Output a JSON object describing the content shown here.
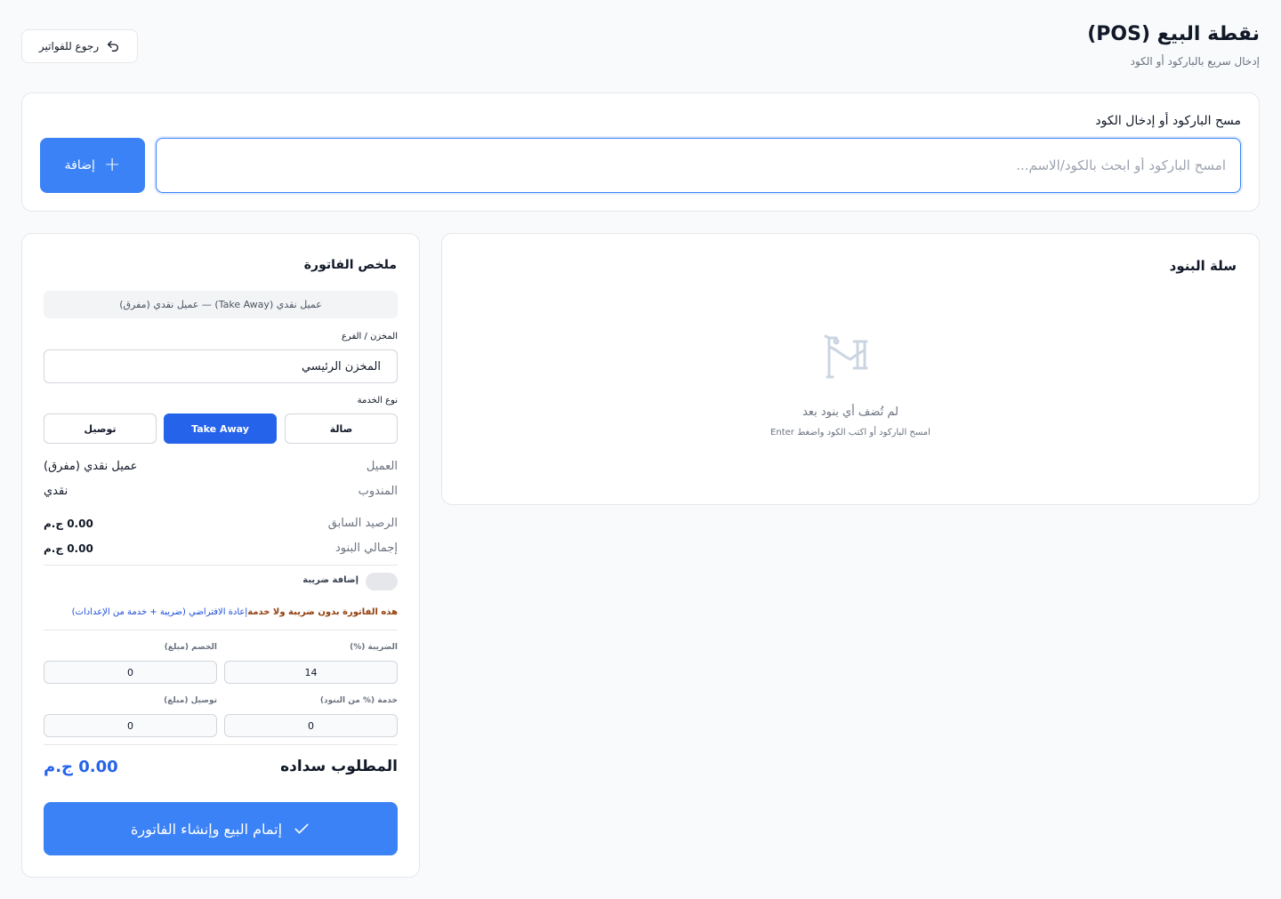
{
  "header": {
    "title": "نقطة البيع (POS)",
    "subtitle": "إدخال سريع بالباركود أو الكود",
    "back_label": "رجوع للفواتير"
  },
  "scan": {
    "label": "مسح الباركود أو إدخال الكود",
    "placeholder": "امسح الباركود أو ابحث بالكود/الاسم...",
    "add_label": "إضافة"
  },
  "cart": {
    "title": "سلة البنود",
    "empty_title": "لم تُضف أي بنود بعد",
    "empty_hint": "امسح الباركود أو اكتب الكود واضغط Enter"
  },
  "summary": {
    "title": "ملخص الفاتورة",
    "customer_line": "عميل نقدي (Take Away) — عميل نقدي (مفرق)",
    "store_label": "المخزن / الفرع",
    "store_value": "المخزن الرئيسي",
    "service_label": "نوع الخدمة",
    "services": [
      "صالة",
      "Take Away",
      "توصيل"
    ],
    "selected_service": "Take Away",
    "customer_key": "العميل",
    "customer_value": "عميل نقدي (مفرق)",
    "rep_key": "المندوب",
    "rep_value": "نقدي",
    "prev_balance_key": "الرصيد السابق",
    "prev_balance_value": "0.00 ج.م",
    "items_total_key": "إجمالي البنود",
    "items_total_value": "0.00 ج.م",
    "tax_toggle_label": "إضافة ضريبة",
    "tax_toggle_on": false,
    "note_warning": "هذه الفاتورة بدون ضريبة ولا خدمة",
    "note_link": "إعادة الافتراضي (ضريبة + خدمة من الإعدادات)",
    "tax_pct_label": "الضريبة (%)",
    "tax_pct_value": "14",
    "discount_label": "الخصم (مبلغ)",
    "discount_value": "0",
    "service_pct_label": "خدمة (% من البنود)",
    "service_pct_value": "0",
    "delivery_label": "توصيل (مبلغ)",
    "delivery_value": "0",
    "due_label": "المطلوب سداده",
    "due_value": "0.00 ج.م",
    "finish_label": "إتمام البيع وإنشاء الفاتورة"
  },
  "colors": {
    "primary": "#3b82f6",
    "primary_dark": "#2563eb",
    "warning": "#92400e",
    "link": "#1d4ed8"
  }
}
